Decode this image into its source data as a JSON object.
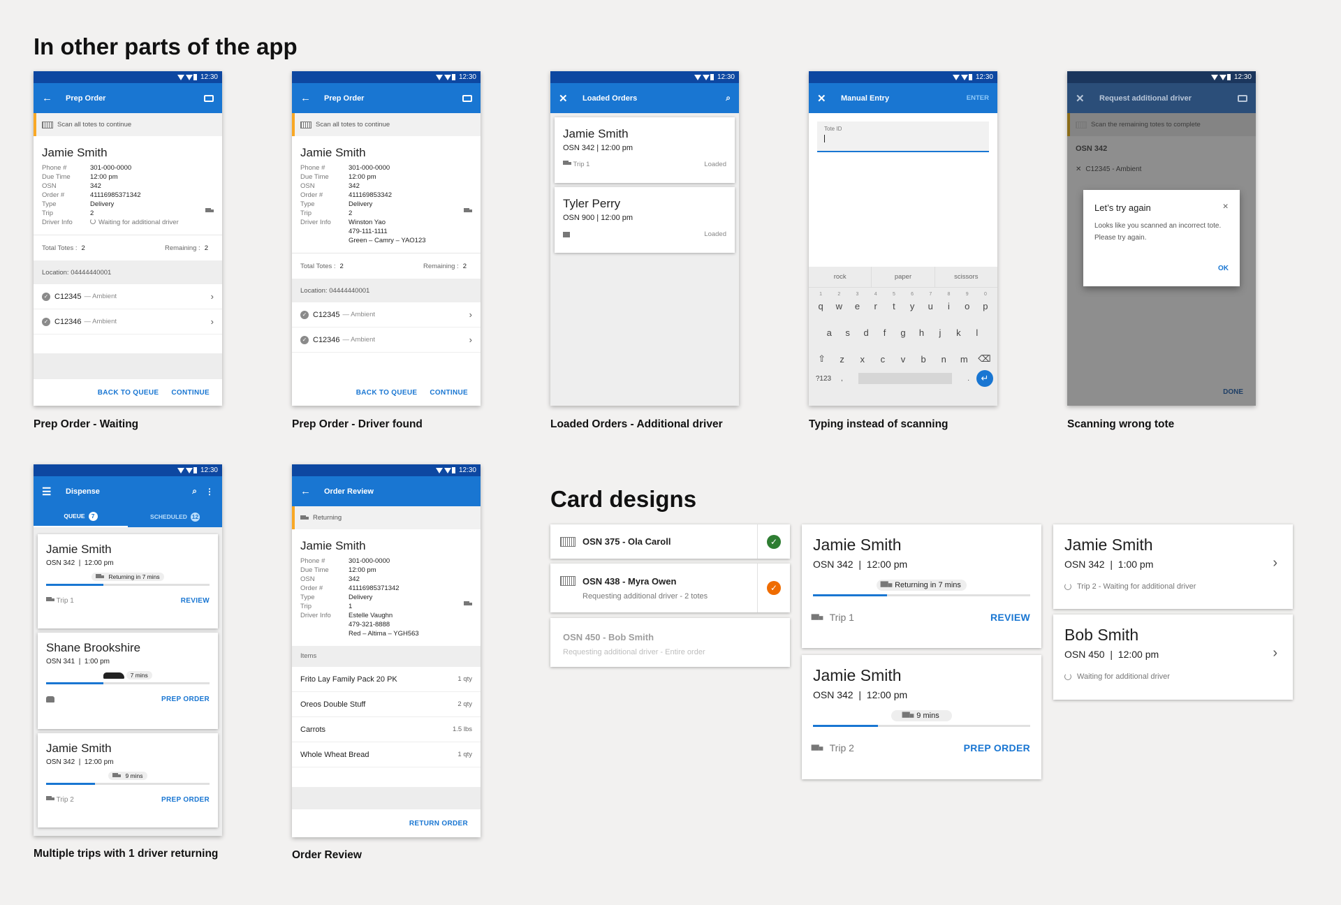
{
  "headings": {
    "other_parts": "In other parts of the app",
    "card_designs": "Card designs"
  },
  "status_time": "12:30",
  "captions": [
    "Prep Order - Waiting",
    "Prep Order - Driver found",
    "Loaded Orders - Additional driver",
    "Typing instead of scanning",
    "Scanning wrong tote",
    "Multiple trips with 1 driver returning",
    "Order Review"
  ],
  "prep_waiting": {
    "title": "Prep Order",
    "banner": "Scan all totes to continue",
    "customer": "Jamie Smith",
    "fields": [
      {
        "k": "Phone #",
        "v": "301-000-0000"
      },
      {
        "k": "Due Time",
        "v": "12:00 pm"
      },
      {
        "k": "OSN",
        "v": "342"
      },
      {
        "k": "Order #",
        "v": "41116985371342"
      },
      {
        "k": "Type",
        "v": "Delivery"
      },
      {
        "k": "Trip",
        "v": "2"
      },
      {
        "k": "Driver Info",
        "v": "Waiting for additional driver"
      }
    ],
    "total_label": "Total Totes :",
    "total": "2",
    "remaining_label": "Remaining :",
    "remaining": "2",
    "location": "Location: 04444440001",
    "totes": [
      {
        "id": "C12345",
        "sub": "— Ambient"
      },
      {
        "id": "C12346",
        "sub": "— Ambient"
      }
    ],
    "back": "BACK TO QUEUE",
    "continue": "CONTINUE"
  },
  "prep_found": {
    "title": "Prep Order",
    "banner": "Scan all totes to continue",
    "customer": "Jamie Smith",
    "fields": [
      {
        "k": "Phone #",
        "v": "301-000-0000"
      },
      {
        "k": "Due Time",
        "v": "12:00 pm"
      },
      {
        "k": "OSN",
        "v": "342"
      },
      {
        "k": "Order #",
        "v": "411169853342"
      },
      {
        "k": "Type",
        "v": "Delivery"
      },
      {
        "k": "Trip",
        "v": "2"
      },
      {
        "k": "Driver Info",
        "v": "Winston Yao"
      },
      {
        "k": "",
        "v": "479-111-1111"
      },
      {
        "k": "",
        "v": "Green – Camry – YAO123"
      }
    ],
    "total_label": "Total Totes :",
    "total": "2",
    "remaining_label": "Remaining :",
    "remaining": "2",
    "location": "Location: 04444440001",
    "totes": [
      {
        "id": "C12345",
        "sub": "— Ambient"
      },
      {
        "id": "C12346",
        "sub": "— Ambient"
      }
    ],
    "back": "BACK TO QUEUE",
    "continue": "CONTINUE"
  },
  "loaded": {
    "title": "Loaded Orders",
    "cards": [
      {
        "name": "Jamie Smith",
        "osn": "OSN 342 | 12:00 pm",
        "trip": "Trip 1",
        "status": "Loaded"
      },
      {
        "name": "Tyler Perry",
        "osn": "OSN 900 | 12:00 pm",
        "trip": "",
        "status": "Loaded"
      }
    ]
  },
  "manual": {
    "title": "Manual Entry",
    "enter": "ENTER",
    "field_label": "Tote ID",
    "suggestions": [
      "rock",
      "paper",
      "scissors"
    ],
    "row1": [
      "q",
      "w",
      "e",
      "r",
      "t",
      "y",
      "u",
      "i",
      "o",
      "p"
    ],
    "row1_nums": [
      "1",
      "2",
      "3",
      "4",
      "5",
      "6",
      "7",
      "8",
      "9",
      "0"
    ],
    "row2": [
      "a",
      "s",
      "d",
      "f",
      "g",
      "h",
      "j",
      "k",
      "l"
    ],
    "row3": [
      "z",
      "x",
      "c",
      "v",
      "b",
      "n",
      "m"
    ],
    "sym": "?123",
    "comma": ",",
    "period": "."
  },
  "wrong": {
    "title": "Request additional driver",
    "banner": "Scan the remaining totes to complete",
    "osn": "OSN 342",
    "tote": "C12345 - Ambient",
    "dialog_title": "Let’s try again",
    "dialog_body": "Looks like you scanned an incorrect tote. Please try again.",
    "ok": "OK",
    "done": "DONE"
  },
  "dispense": {
    "title": "Dispense",
    "tab_queue": "QUEUE",
    "tab_queue_count": "7",
    "tab_scheduled": "SCHEDULED",
    "tab_scheduled_count": "12",
    "cards": [
      {
        "name": "Jamie Smith",
        "osn": "OSN 342  |  12:00 pm",
        "pill": "Returning in 7 mins",
        "progress": 0.35,
        "trip": "Trip 1",
        "action": "REVIEW"
      },
      {
        "name": "Shane Brookshire",
        "osn": "OSN 341  |  1:00 pm",
        "pill": "7 mins",
        "progress": 0.35,
        "trip": "",
        "action": "PREP ORDER"
      },
      {
        "name": "Jamie Smith",
        "osn": "OSN 342  |  12:00 pm",
        "pill": "9 mins",
        "progress": 0.3,
        "trip": "Trip 2",
        "action": "PREP ORDER"
      }
    ]
  },
  "review": {
    "title": "Order Review",
    "banner": "Returning",
    "customer": "Jamie Smith",
    "fields": [
      {
        "k": "Phone #",
        "v": "301-000-0000"
      },
      {
        "k": "Due Time",
        "v": "12:00 pm"
      },
      {
        "k": "OSN",
        "v": "342"
      },
      {
        "k": "Order #",
        "v": "41116985371342"
      },
      {
        "k": "Type",
        "v": "Delivery"
      },
      {
        "k": "Trip",
        "v": "1"
      },
      {
        "k": "Driver Info",
        "v": "Estelle Vaughn"
      },
      {
        "k": "",
        "v": "479-321-8888"
      },
      {
        "k": "",
        "v": "Red – Altima – YGH563"
      }
    ],
    "items_label": "Items",
    "items": [
      {
        "name": "Frito Lay Family Pack 20 PK",
        "qty": "1 qty"
      },
      {
        "name": "Oreos Double Stuff",
        "qty": "2 qty"
      },
      {
        "name": "Carrots",
        "qty": "1.5 lbs"
      },
      {
        "name": "Whole Wheat Bread",
        "qty": "1 qty"
      }
    ],
    "action": "RETURN ORDER"
  },
  "designs": {
    "list": [
      {
        "title": "OSN 375 - Ola Caroll",
        "sub": "",
        "status_color": "#2e7d32"
      },
      {
        "title": "OSN 438 - Myra Owen",
        "sub": "Requesting additional driver - 2 totes",
        "status_color": "#ef6c00"
      },
      {
        "title": "OSN 450 - Bob Smith",
        "sub": "Requesting additional driver - Entire order",
        "status_color": ""
      }
    ],
    "big": [
      {
        "name": "Jamie Smith",
        "osn": "OSN 342  |  12:00 pm",
        "pill": "Returning in 7 mins",
        "progress": 0.34,
        "trip": "Trip 1",
        "action": "REVIEW"
      },
      {
        "name": "Jamie Smith",
        "osn": "OSN 342  |  12:00 pm",
        "pill": "9 mins",
        "progress": 0.3,
        "trip": "Trip 2",
        "action": "PREP ORDER"
      }
    ],
    "wide": [
      {
        "name": "Jamie Smith",
        "osn": "OSN 342  |  1:00 pm",
        "status": "Trip 2 - Waiting for additional driver"
      },
      {
        "name": "Bob Smith",
        "osn": "OSN 450  |  12:00 pm",
        "status": "Waiting for additional driver"
      }
    ]
  }
}
